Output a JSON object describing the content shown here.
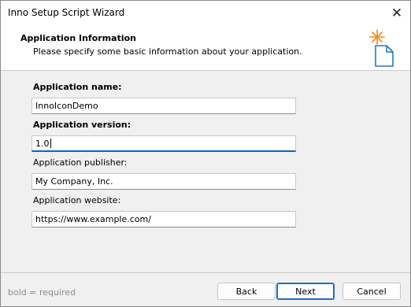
{
  "window": {
    "title": "Inno Setup Script Wizard"
  },
  "header": {
    "title": "Application Information",
    "subtitle": "Please specify some basic information about your application."
  },
  "fields": {
    "name": {
      "label": "Application name:",
      "value": "InnoIconDemo",
      "required": true
    },
    "version": {
      "label": "Application version:",
      "value": "1.0",
      "required": true
    },
    "publisher": {
      "label": "Application publisher:",
      "value": "My Company, Inc.",
      "required": false
    },
    "website": {
      "label": "Application website:",
      "value": "https://www.example.com/",
      "required": false
    }
  },
  "footer": {
    "legend": "bold = required",
    "back_label": "Back",
    "next_label": "Next",
    "cancel_label": "Cancel"
  },
  "colors": {
    "accent": "#0a64c8",
    "spark_orange": "#f08c1e",
    "doc_blue": "#1e78d2"
  },
  "icons": {
    "close": "close-icon",
    "wizard": "wizard-document-icon"
  }
}
